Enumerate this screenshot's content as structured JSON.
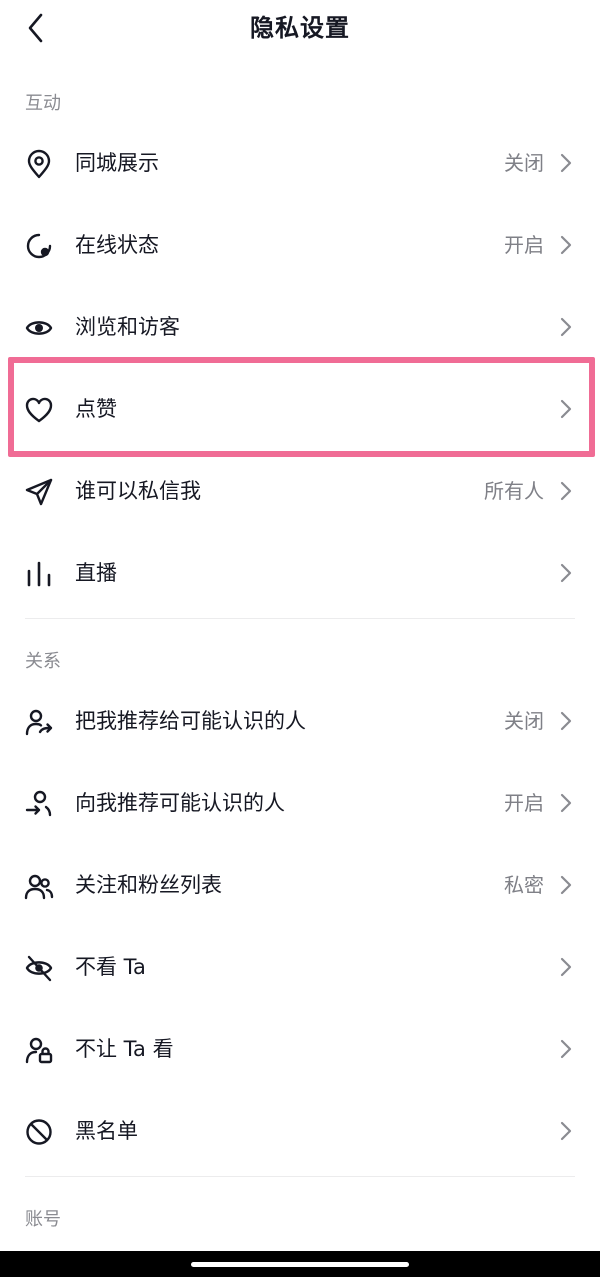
{
  "header": {
    "title": "隐私设置",
    "back_icon": "chevron-left-icon"
  },
  "sections": [
    {
      "title": "互动",
      "items": [
        {
          "label": "同城展示",
          "value": "关闭",
          "icon": "location-pin-icon"
        },
        {
          "label": "在线状态",
          "value": "开启",
          "icon": "online-status-icon"
        },
        {
          "label": "浏览和访客",
          "value": "",
          "icon": "eye-icon"
        },
        {
          "label": "点赞",
          "value": "",
          "icon": "heart-icon",
          "highlighted": true
        },
        {
          "label": "谁可以私信我",
          "value": "所有人",
          "icon": "paper-plane-icon"
        },
        {
          "label": "直播",
          "value": "",
          "icon": "live-bars-icon"
        }
      ]
    },
    {
      "title": "关系",
      "items": [
        {
          "label": "把我推荐给可能认识的人",
          "value": "关闭",
          "icon": "user-share-icon"
        },
        {
          "label": "向我推荐可能认识的人",
          "value": "开启",
          "icon": "user-incoming-icon"
        },
        {
          "label": "关注和粉丝列表",
          "value": "私密",
          "icon": "users-icon"
        },
        {
          "label": "不看 Ta",
          "value": "",
          "icon": "eye-off-icon"
        },
        {
          "label": "不让 Ta 看",
          "value": "",
          "icon": "user-lock-icon"
        },
        {
          "label": "黑名单",
          "value": "",
          "icon": "block-icon"
        }
      ]
    },
    {
      "title": "账号",
      "items": []
    }
  ],
  "colors": {
    "highlight": "#f06c95",
    "text_primary": "#161823",
    "text_secondary": "#7f8087",
    "section_header": "#8a8b91"
  }
}
